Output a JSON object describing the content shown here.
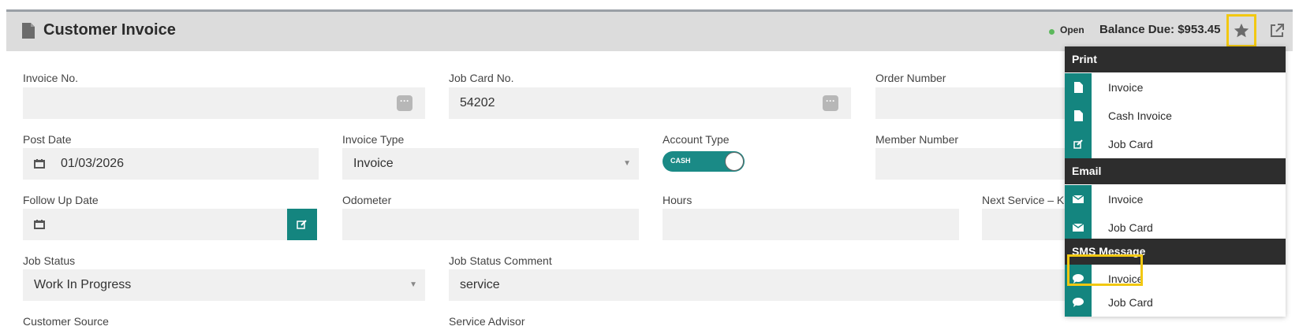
{
  "header": {
    "title": "Customer Invoice",
    "status": "Open",
    "balance": "Balance Due: $953.45",
    "status_color": "#5cb85c",
    "icons": [
      "document-icon",
      "star-icon",
      "external-link-icon"
    ]
  },
  "form": {
    "invoice_no": {
      "label": "Invoice No.",
      "value": ""
    },
    "job_card_no": {
      "label": "Job Card No.",
      "value": "54202"
    },
    "order_number": {
      "label": "Order Number",
      "value": ""
    },
    "post_date": {
      "label": "Post Date",
      "value": "01/03/2026"
    },
    "invoice_type": {
      "label": "Invoice Type",
      "value": "Invoice"
    },
    "account_type": {
      "label": "Account Type",
      "value": "CASH"
    },
    "member_number": {
      "label": "Member Number",
      "value": ""
    },
    "follow_up_date": {
      "label": "Follow Up Date",
      "value": ""
    },
    "odometer": {
      "label": "Odometer",
      "value": ""
    },
    "hours": {
      "label": "Hours",
      "value": ""
    },
    "next_service": {
      "label": "Next Service – K",
      "value": ""
    },
    "job_status": {
      "label": "Job Status",
      "value": "Work In Progress"
    },
    "job_status_comment": {
      "label": "Job Status Comment",
      "value": "service"
    },
    "customer_source": {
      "label": "Customer Source"
    },
    "service_advisor": {
      "label": "Service Advisor"
    }
  },
  "menu": {
    "sections": [
      {
        "title": "Print",
        "items": [
          "Invoice",
          "Cash Invoice",
          "Job Card"
        ]
      },
      {
        "title": "Email",
        "items": [
          "Invoice",
          "Job Card"
        ]
      },
      {
        "title": "SMS Message",
        "items": [
          "Invoice",
          "Job Card"
        ]
      }
    ]
  },
  "colors": {
    "accent": "#14857f",
    "highlight": "#f2c811",
    "menu_header": "#2d2d2d"
  }
}
